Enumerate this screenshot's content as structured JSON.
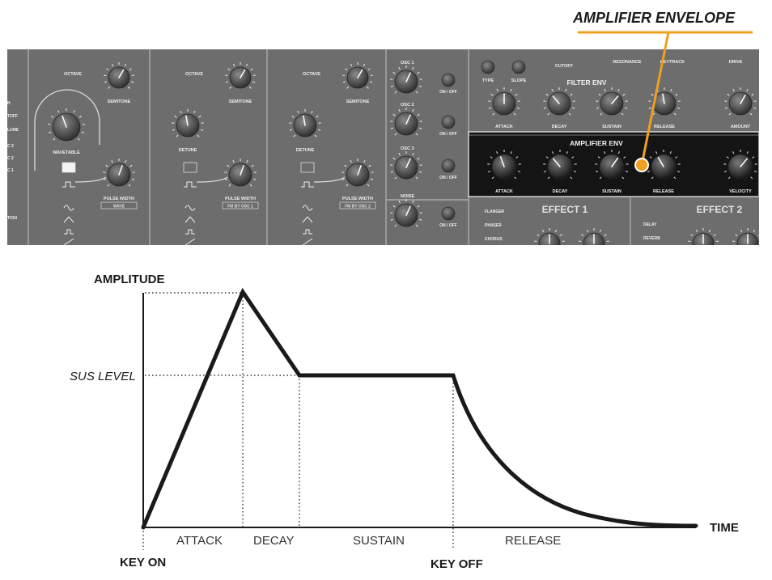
{
  "callout": {
    "title": "AMPLIFIER ENVELOPE"
  },
  "synth_panel": {
    "columns": [
      {
        "octave": "OCTAVE",
        "semitone": "SEMITONE",
        "knob3": "WAVETABLE",
        "pw": "PULSE WIDTH",
        "pw_tag": "WAVE"
      },
      {
        "octave": "OCTAVE",
        "semitone": "SEMITONE",
        "knob3": "DETUNE",
        "pw": "PULSE WIDTH",
        "pw_tag": "FM BY OSC 1"
      },
      {
        "octave": "OCTAVE",
        "semitone": "SEMITONE",
        "knob3": "DETUNE",
        "pw": "PULSE WIDTH",
        "pw_tag": "FM BY OSC 2"
      }
    ],
    "mixer": [
      "OSC 1",
      "OSC 2",
      "OSC 3",
      "NOISE"
    ],
    "on_off": "ON / OFF",
    "filter": {
      "top": [
        "CUTOFF",
        "RESONANCE",
        "KEYTRACK",
        "DRIVE"
      ],
      "buttons": [
        "TYPE",
        "SLOPE"
      ],
      "env_title": "FILTER ENV",
      "env_knobs": [
        "ATTACK",
        "DECAY",
        "SUSTAIN",
        "RELEASE",
        "AMOUNT"
      ]
    },
    "amp_env": {
      "title": "AMPLIFIER ENV",
      "knobs": [
        "ATTACK",
        "DECAY",
        "SUSTAIN",
        "RELEASE",
        "VELOCITY"
      ]
    },
    "effects": [
      {
        "title": "EFFECT 1",
        "items": [
          "FLANGER",
          "PHASER",
          "CHORUS"
        ]
      },
      {
        "title": "EFFECT 2",
        "items": [
          "DELAY",
          "REVERB"
        ]
      }
    ]
  },
  "envelope": {
    "y_label": "AMPLITUDE",
    "x_label": "TIME",
    "sus_label": "SUS LEVEL",
    "key_on": "KEY ON",
    "key_off": "KEY OFF",
    "phases": [
      "ATTACK",
      "DECAY",
      "SUSTAIN",
      "RELEASE"
    ]
  }
}
